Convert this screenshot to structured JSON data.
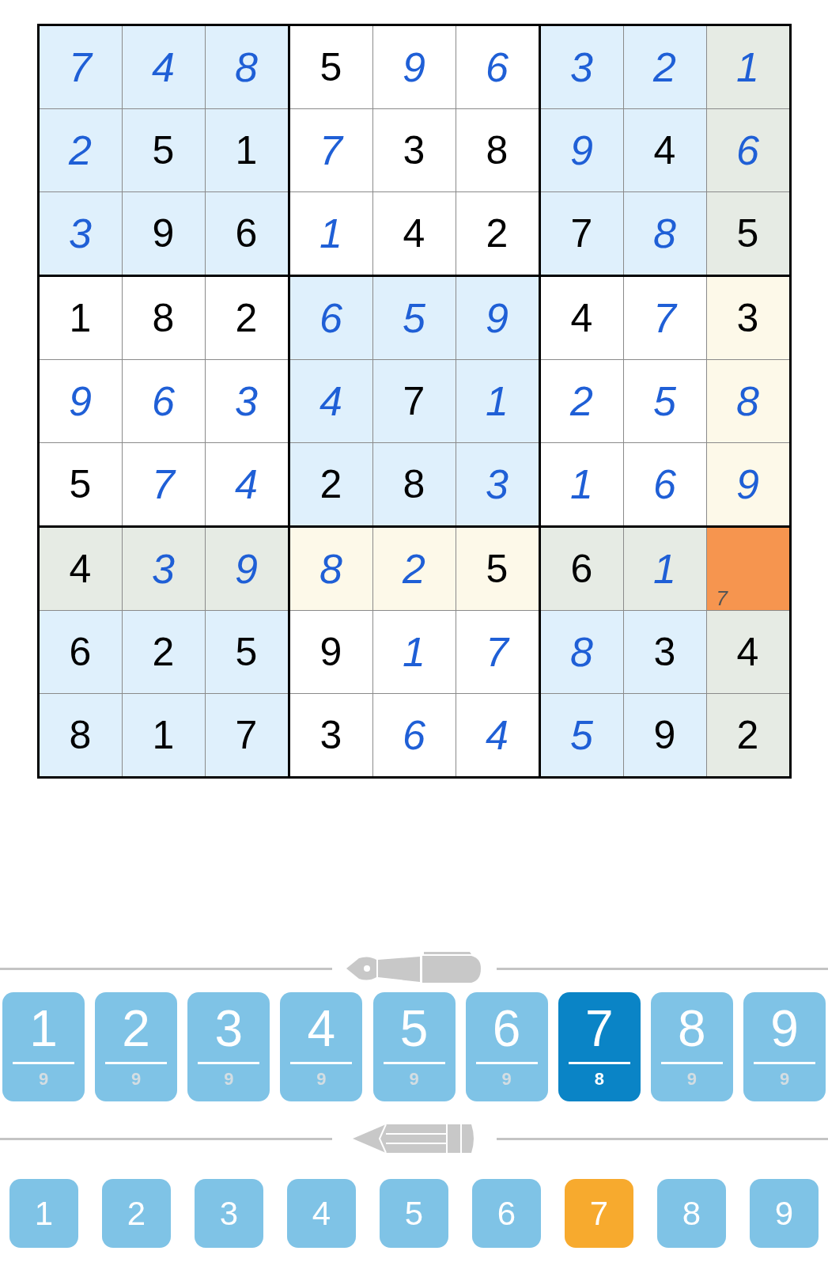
{
  "grid": [
    [
      {
        "value": "7",
        "kind": "entered",
        "color": "#dff0fc"
      },
      {
        "value": "4",
        "kind": "entered",
        "color": "#dff0fc"
      },
      {
        "value": "8",
        "kind": "entered",
        "color": "#dff0fc"
      },
      {
        "value": "5",
        "kind": "given",
        "color": "#ffffff"
      },
      {
        "value": "9",
        "kind": "entered",
        "color": "#ffffff"
      },
      {
        "value": "6",
        "kind": "entered",
        "color": "#ffffff"
      },
      {
        "value": "3",
        "kind": "entered",
        "color": "#dff0fc"
      },
      {
        "value": "2",
        "kind": "entered",
        "color": "#dff0fc"
      },
      {
        "value": "1",
        "kind": "entered",
        "color": "#e6ebe4"
      }
    ],
    [
      {
        "value": "2",
        "kind": "entered",
        "color": "#dff0fc"
      },
      {
        "value": "5",
        "kind": "given",
        "color": "#dff0fc"
      },
      {
        "value": "1",
        "kind": "given",
        "color": "#dff0fc"
      },
      {
        "value": "7",
        "kind": "entered",
        "color": "#ffffff"
      },
      {
        "value": "3",
        "kind": "given",
        "color": "#ffffff"
      },
      {
        "value": "8",
        "kind": "given",
        "color": "#ffffff"
      },
      {
        "value": "9",
        "kind": "entered",
        "color": "#dff0fc"
      },
      {
        "value": "4",
        "kind": "given",
        "color": "#dff0fc"
      },
      {
        "value": "6",
        "kind": "entered",
        "color": "#e6ebe4"
      }
    ],
    [
      {
        "value": "3",
        "kind": "entered",
        "color": "#dff0fc"
      },
      {
        "value": "9",
        "kind": "given",
        "color": "#dff0fc"
      },
      {
        "value": "6",
        "kind": "given",
        "color": "#dff0fc"
      },
      {
        "value": "1",
        "kind": "entered",
        "color": "#ffffff"
      },
      {
        "value": "4",
        "kind": "given",
        "color": "#ffffff"
      },
      {
        "value": "2",
        "kind": "given",
        "color": "#ffffff"
      },
      {
        "value": "7",
        "kind": "given",
        "color": "#dff0fc"
      },
      {
        "value": "8",
        "kind": "entered",
        "color": "#dff0fc"
      },
      {
        "value": "5",
        "kind": "given",
        "color": "#e6ebe4"
      }
    ],
    [
      {
        "value": "1",
        "kind": "given",
        "color": "#ffffff"
      },
      {
        "value": "8",
        "kind": "given",
        "color": "#ffffff"
      },
      {
        "value": "2",
        "kind": "given",
        "color": "#ffffff"
      },
      {
        "value": "6",
        "kind": "entered",
        "color": "#dff0fc"
      },
      {
        "value": "5",
        "kind": "entered",
        "color": "#dff0fc"
      },
      {
        "value": "9",
        "kind": "entered",
        "color": "#dff0fc"
      },
      {
        "value": "4",
        "kind": "given",
        "color": "#ffffff"
      },
      {
        "value": "7",
        "kind": "entered",
        "color": "#ffffff"
      },
      {
        "value": "3",
        "kind": "given",
        "color": "#fdf9e9"
      }
    ],
    [
      {
        "value": "9",
        "kind": "entered",
        "color": "#ffffff"
      },
      {
        "value": "6",
        "kind": "entered",
        "color": "#ffffff"
      },
      {
        "value": "3",
        "kind": "entered",
        "color": "#ffffff"
      },
      {
        "value": "4",
        "kind": "entered",
        "color": "#dff0fc"
      },
      {
        "value": "7",
        "kind": "given",
        "color": "#dff0fc"
      },
      {
        "value": "1",
        "kind": "entered",
        "color": "#dff0fc"
      },
      {
        "value": "2",
        "kind": "entered",
        "color": "#ffffff"
      },
      {
        "value": "5",
        "kind": "entered",
        "color": "#ffffff"
      },
      {
        "value": "8",
        "kind": "entered",
        "color": "#fdf9e9"
      }
    ],
    [
      {
        "value": "5",
        "kind": "given",
        "color": "#ffffff"
      },
      {
        "value": "7",
        "kind": "entered",
        "color": "#ffffff"
      },
      {
        "value": "4",
        "kind": "entered",
        "color": "#ffffff"
      },
      {
        "value": "2",
        "kind": "given",
        "color": "#dff0fc"
      },
      {
        "value": "8",
        "kind": "given",
        "color": "#dff0fc"
      },
      {
        "value": "3",
        "kind": "entered",
        "color": "#dff0fc"
      },
      {
        "value": "1",
        "kind": "entered",
        "color": "#ffffff"
      },
      {
        "value": "6",
        "kind": "entered",
        "color": "#ffffff"
      },
      {
        "value": "9",
        "kind": "entered",
        "color": "#fdf9e9"
      }
    ],
    [
      {
        "value": "4",
        "kind": "given",
        "color": "#e6ebe4"
      },
      {
        "value": "3",
        "kind": "entered",
        "color": "#e6ebe4"
      },
      {
        "value": "9",
        "kind": "entered",
        "color": "#e6ebe4"
      },
      {
        "value": "8",
        "kind": "entered",
        "color": "#fdf9e9"
      },
      {
        "value": "2",
        "kind": "entered",
        "color": "#fdf9e9"
      },
      {
        "value": "5",
        "kind": "given",
        "color": "#fdf9e9"
      },
      {
        "value": "6",
        "kind": "given",
        "color": "#e6ebe4"
      },
      {
        "value": "1",
        "kind": "entered",
        "color": "#e6ebe4"
      },
      {
        "color": "#f6954f",
        "note": "7"
      }
    ],
    [
      {
        "value": "6",
        "kind": "given",
        "color": "#dff0fc"
      },
      {
        "value": "2",
        "kind": "given",
        "color": "#dff0fc"
      },
      {
        "value": "5",
        "kind": "given",
        "color": "#dff0fc"
      },
      {
        "value": "9",
        "kind": "given",
        "color": "#ffffff"
      },
      {
        "value": "1",
        "kind": "entered",
        "color": "#ffffff"
      },
      {
        "value": "7",
        "kind": "entered",
        "color": "#ffffff"
      },
      {
        "value": "8",
        "kind": "entered",
        "color": "#dff0fc"
      },
      {
        "value": "3",
        "kind": "given",
        "color": "#dff0fc"
      },
      {
        "value": "4",
        "kind": "given",
        "color": "#e6ebe4"
      }
    ],
    [
      {
        "value": "8",
        "kind": "given",
        "color": "#dff0fc"
      },
      {
        "value": "1",
        "kind": "given",
        "color": "#dff0fc"
      },
      {
        "value": "7",
        "kind": "given",
        "color": "#dff0fc"
      },
      {
        "value": "3",
        "kind": "given",
        "color": "#ffffff"
      },
      {
        "value": "6",
        "kind": "entered",
        "color": "#ffffff"
      },
      {
        "value": "4",
        "kind": "entered",
        "color": "#ffffff"
      },
      {
        "value": "5",
        "kind": "entered",
        "color": "#dff0fc"
      },
      {
        "value": "9",
        "kind": "given",
        "color": "#dff0fc"
      },
      {
        "value": "2",
        "kind": "given",
        "color": "#e6ebe4"
      }
    ]
  ],
  "pen_keys": [
    {
      "digit": "1",
      "remaining": "9",
      "selected": false
    },
    {
      "digit": "2",
      "remaining": "9",
      "selected": false
    },
    {
      "digit": "3",
      "remaining": "9",
      "selected": false
    },
    {
      "digit": "4",
      "remaining": "9",
      "selected": false
    },
    {
      "digit": "5",
      "remaining": "9",
      "selected": false
    },
    {
      "digit": "6",
      "remaining": "9",
      "selected": false
    },
    {
      "digit": "7",
      "remaining": "8",
      "selected": true
    },
    {
      "digit": "8",
      "remaining": "9",
      "selected": false
    },
    {
      "digit": "9",
      "remaining": "9",
      "selected": false
    }
  ],
  "pencil_keys": [
    {
      "digit": "1",
      "selected": false
    },
    {
      "digit": "2",
      "selected": false
    },
    {
      "digit": "3",
      "selected": false
    },
    {
      "digit": "4",
      "selected": false
    },
    {
      "digit": "5",
      "selected": false
    },
    {
      "digit": "6",
      "selected": false
    },
    {
      "digit": "7",
      "selected": true
    },
    {
      "digit": "8",
      "selected": false
    },
    {
      "digit": "9",
      "selected": false
    }
  ]
}
